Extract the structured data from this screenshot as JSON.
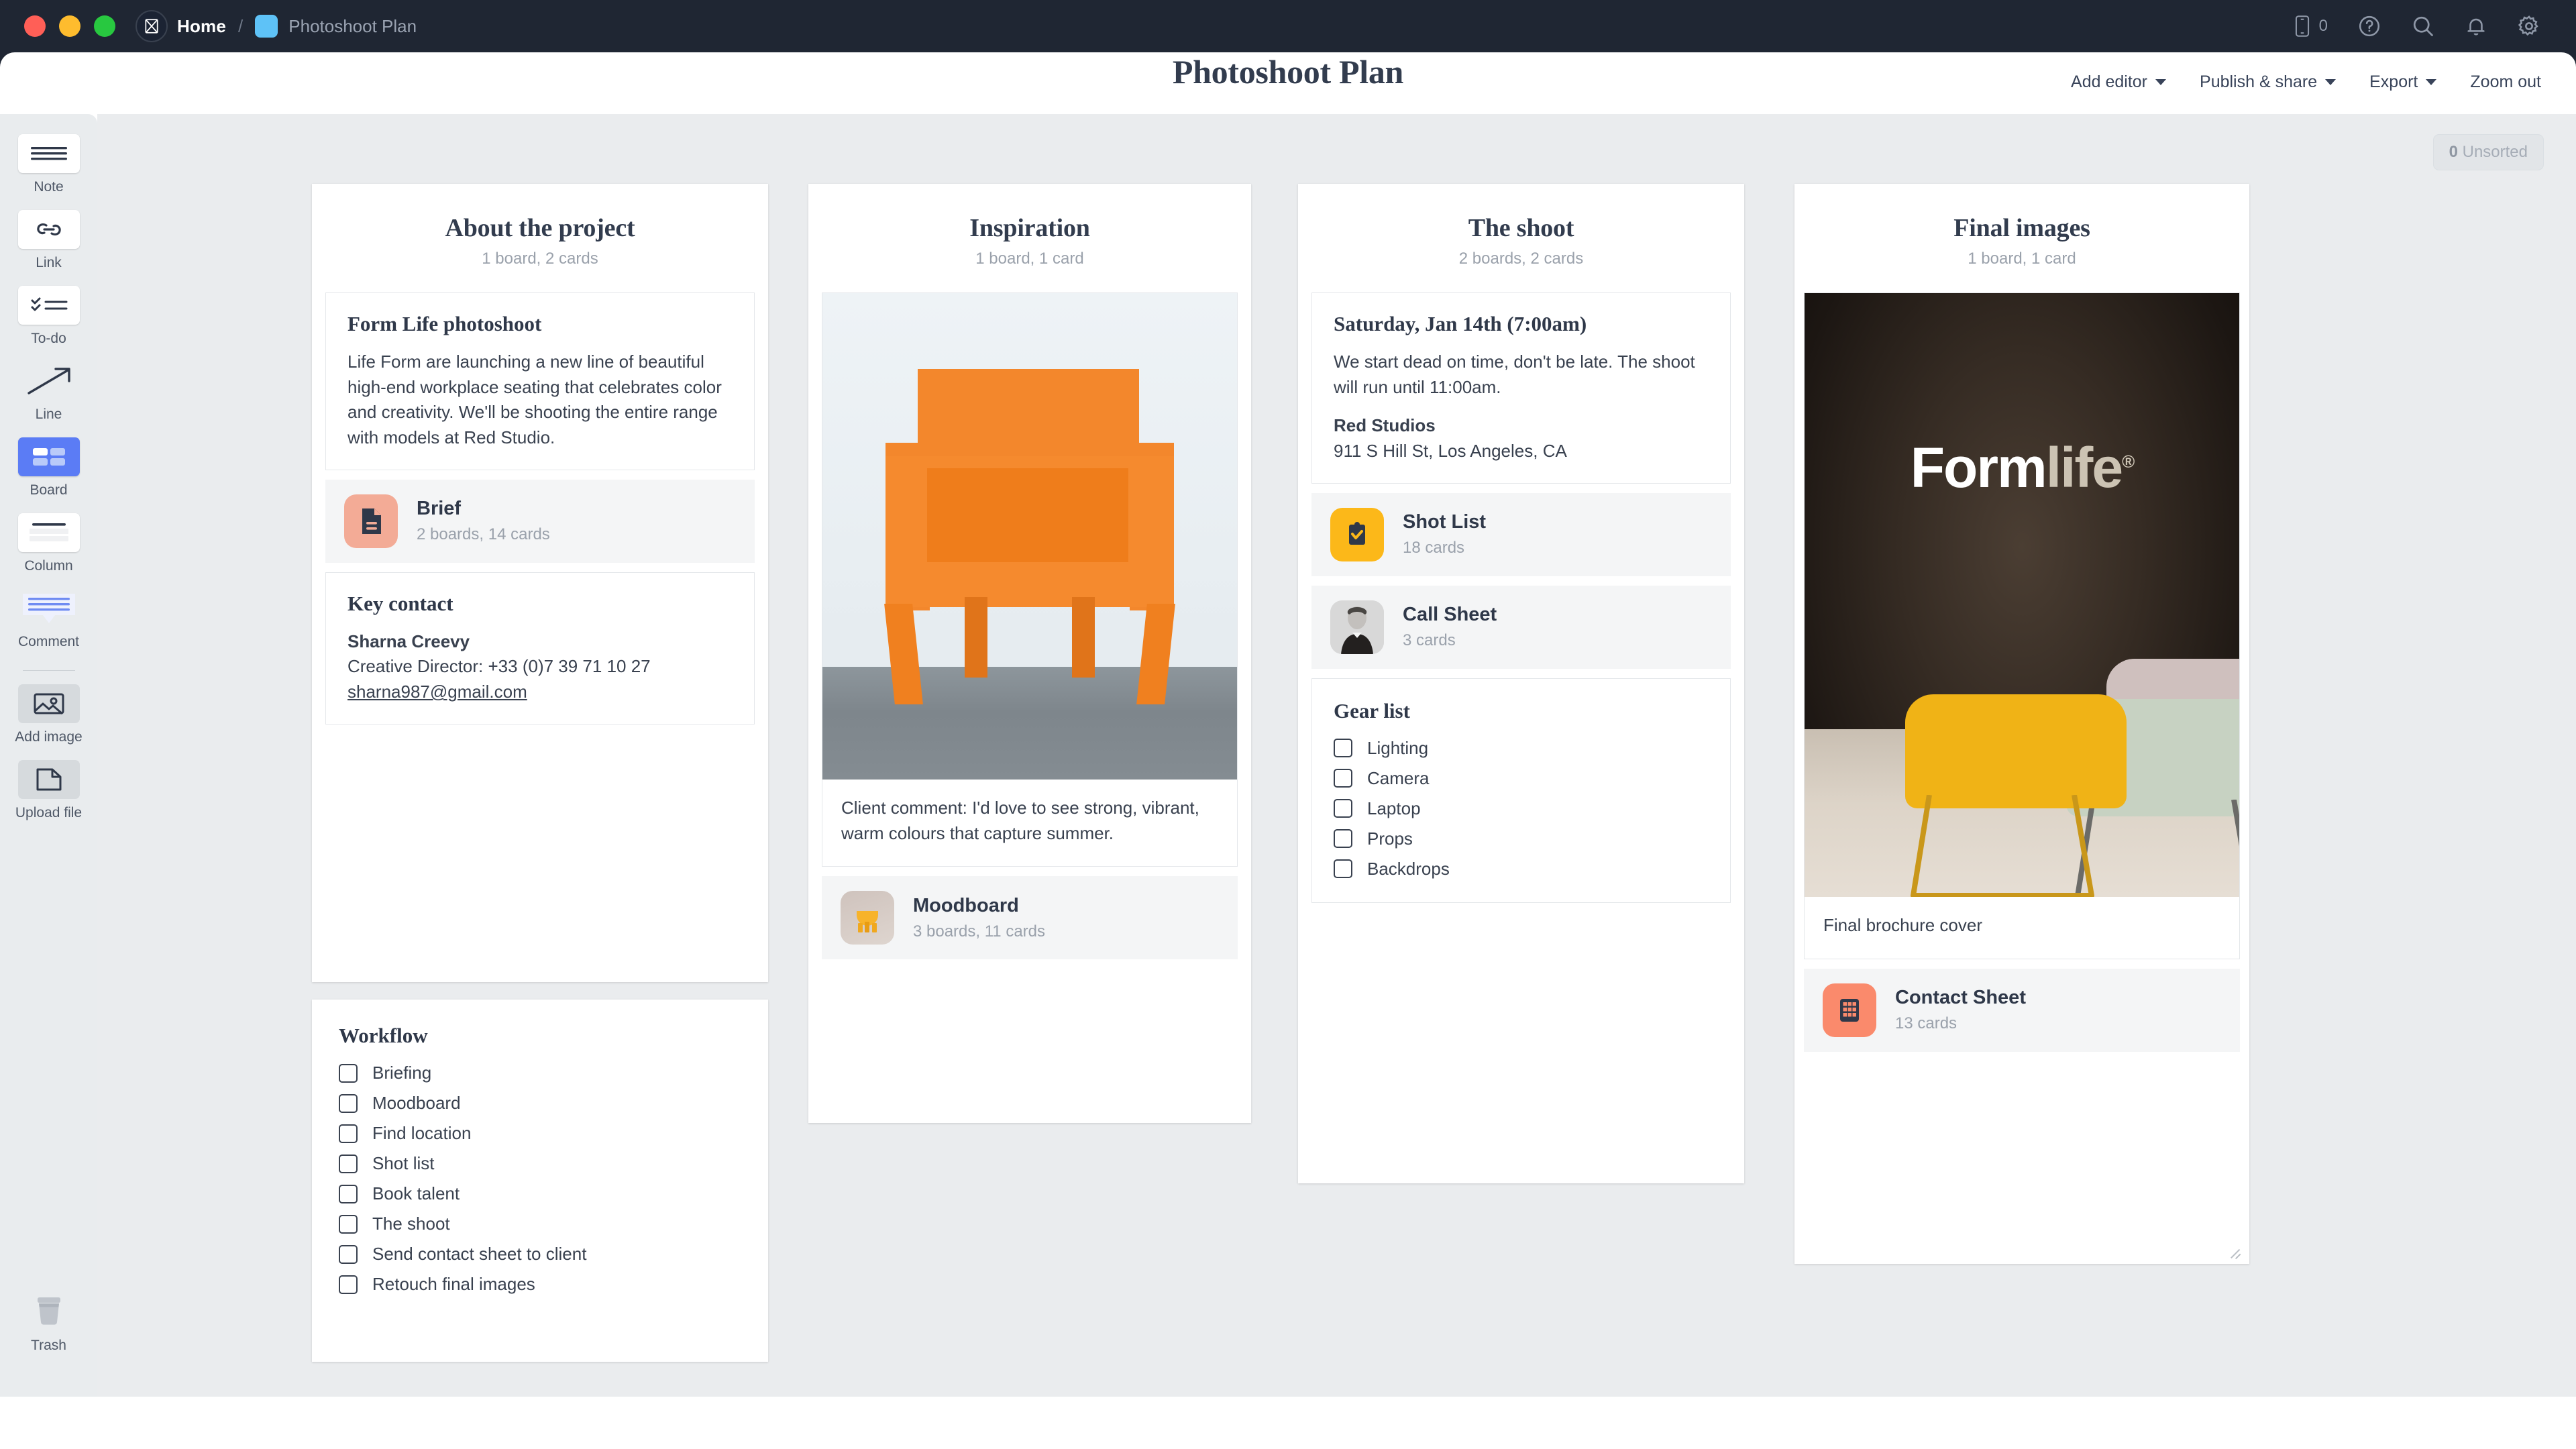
{
  "titlebar": {
    "breadcrumb_home": "Home",
    "breadcrumb_separator": "/",
    "breadcrumb_current": "Photoshoot Plan",
    "mobile_count": "0",
    "icons": [
      "mobile-icon",
      "help-icon",
      "search-icon",
      "bell-icon",
      "gear-icon"
    ]
  },
  "document": {
    "title": "Photoshoot Plan",
    "actions": [
      {
        "label": "Add editor",
        "has_caret": true
      },
      {
        "label": "Publish & share",
        "has_caret": true
      },
      {
        "label": "Export",
        "has_caret": true
      },
      {
        "label": "Zoom out",
        "has_caret": false
      }
    ]
  },
  "toolbar": {
    "items": [
      {
        "label": "Note",
        "icon": "note-icon"
      },
      {
        "label": "Link",
        "icon": "link-icon"
      },
      {
        "label": "To-do",
        "icon": "todo-icon"
      },
      {
        "label": "Line",
        "icon": "line-arrow-icon"
      },
      {
        "label": "Board",
        "icon": "board-icon"
      },
      {
        "label": "Column",
        "icon": "column-icon"
      },
      {
        "label": "Comment",
        "icon": "comment-icon"
      },
      {
        "label": "Add image",
        "icon": "image-icon"
      },
      {
        "label": "Upload file",
        "icon": "file-icon"
      }
    ],
    "trash_label": "Trash"
  },
  "canvas": {
    "unsorted_count": "0",
    "unsorted_label": "Unsorted"
  },
  "columns": [
    {
      "title": "About the project",
      "subtitle": "1 board, 2 cards",
      "note": {
        "heading": "Form Life photoshoot",
        "body": "Life Form are launching a new line of beautiful high-end workplace seating that celebrates color and creativity. We'll be shooting the entire range with models at Red Studio."
      },
      "link_card": {
        "name": "Brief",
        "sub": "2 boards, 14 cards",
        "icon": "document-board-icon",
        "color": "#f3ab96"
      },
      "contact": {
        "heading": "Key contact",
        "name": "Sharna Creevy",
        "role_phone": "Creative Director: +33 (0)7 39 71 10 27",
        "email": "sharna987@gmail.com"
      },
      "checklist": {
        "heading": "Workflow",
        "items": [
          "Briefing",
          "Moodboard",
          "Find location",
          "Shot list",
          "Book talent",
          "The shoot",
          "Send contact sheet to client",
          "Retouch final images"
        ]
      }
    },
    {
      "title": "Inspiration",
      "subtitle": "1 board, 1 card",
      "image_caption": "Client comment: I'd love to see strong, vibrant, warm colours that capture summer.",
      "image_alt": "orange-armchair-photo",
      "link_card": {
        "name": "Moodboard",
        "sub": "3 boards, 11 cards",
        "icon": "yellow-chair-thumbnail"
      }
    },
    {
      "title": "The shoot",
      "subtitle": "2 boards, 2 cards",
      "note": {
        "heading": "Saturday, Jan 14th (7:00am)",
        "body": "We start dead on time, don't be late. The shoot will run until 11:00am.",
        "venue": "Red Studios",
        "address": "911 S Hill St, Los Angeles, CA"
      },
      "link_cards": [
        {
          "name": "Shot List",
          "sub": "18 cards",
          "icon": "clipboard-check-icon",
          "color": "#fcb819"
        },
        {
          "name": "Call Sheet",
          "sub": "3 cards",
          "icon": "model-portrait-thumbnail"
        }
      ],
      "checklist": {
        "heading": "Gear list",
        "items": [
          "Lighting",
          "Camera",
          "Laptop",
          "Props",
          "Backdrops"
        ]
      }
    },
    {
      "title": "Final images",
      "subtitle": "1 board, 1 card",
      "image_caption": "Final brochure cover",
      "image_alt": "formlife-chairs-photo",
      "image_text": {
        "part1": "Form",
        "part2": "life",
        "mark": "®"
      },
      "link_card": {
        "name": "Contact Sheet",
        "sub": "13 cards",
        "icon": "grid-contact-sheet-icon",
        "color": "#fa8a6c"
      }
    }
  ]
}
